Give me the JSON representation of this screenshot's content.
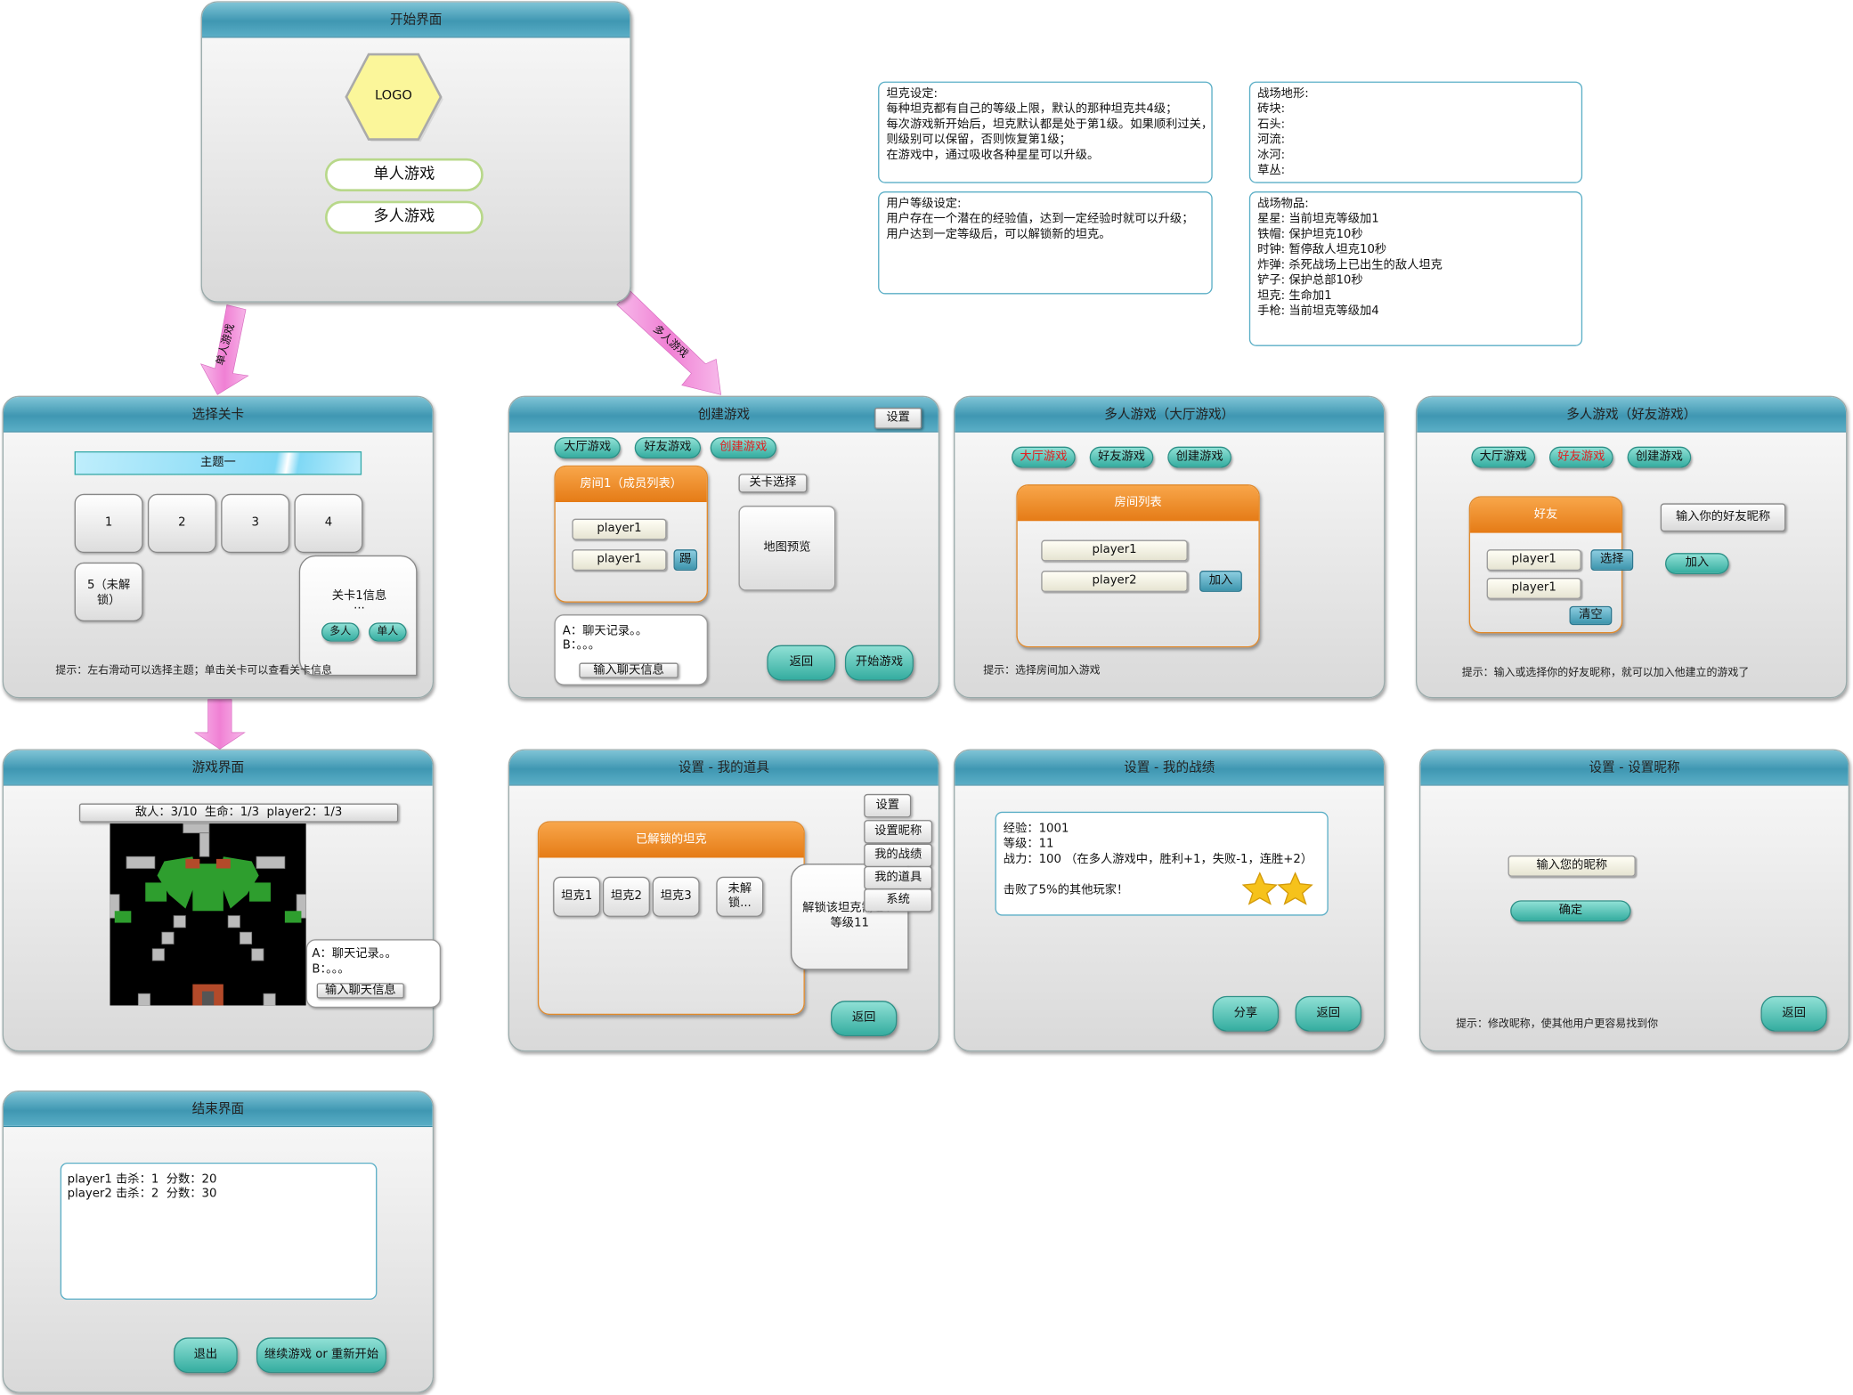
{
  "start": {
    "title": "开始界面",
    "logo": "LOGO",
    "single": "单人游戏",
    "multi": "多人游戏"
  },
  "arrows": {
    "left": "单人游戏",
    "right": "多人游戏"
  },
  "notes": {
    "tank": "坦克设定:\n每种坦克都有自己的等级上限，默认的那种坦克共4级；\n每次游戏新开始后，坦克默认都是处于第1级。如果顺利过关，\n则级别可以保留，否则恢复第1级；\n在游戏中，通过吸收各种星星可以升级。",
    "user": "用户等级设定:\n用户存在一个潜在的经验值，达到一定经验时就可以升级；\n用户达到一定等级后，可以解锁新的坦克。",
    "terrain": "战场地形:\n砖块:\n石头:\n河流:\n冰河:\n草丛:",
    "items": "战场物品:\n星星: 当前坦克等级加1\n铁帽: 保护坦克10秒\n时钟: 暂停敌人坦克10秒\n炸弹: 杀死战场上已出生的敌人坦克\n铲子: 保护总部10秒\n坦克: 生命加1\n手枪: 当前坦克等级加4"
  },
  "level": {
    "title": "选择关卡",
    "theme": "主题一",
    "tiles": [
      "1",
      "2",
      "3",
      "4"
    ],
    "locked": "5（未解锁）",
    "info_title": "关卡1信息",
    "info_dots": "...",
    "multi": "多人",
    "single": "单人",
    "hint": "提示：左右滑动可以选择主题；单击关卡可以查看关卡信息"
  },
  "create": {
    "title": "创建游戏",
    "settings": "设置",
    "tabs": [
      "大厅游戏",
      "好友游戏",
      "创建游戏"
    ],
    "room": "房间1（成员列表）",
    "players": [
      "player1",
      "player1"
    ],
    "kick": "踢",
    "level_select": "关卡选择",
    "preview": "地图预览",
    "chat_a": "A：聊天记录。。",
    "chat_b": "B：。。。",
    "chat_input": "输入聊天信息",
    "back": "返回",
    "start": "开始游戏"
  },
  "lobby": {
    "title": "多人游戏（大厅游戏）",
    "tabs": [
      "大厅游戏",
      "好友游戏",
      "创建游戏"
    ],
    "list": "房间列表",
    "players": [
      "player1",
      "player2"
    ],
    "join": "加入",
    "hint": "提示：选择房间加入游戏"
  },
  "friend": {
    "title": "多人游戏（好友游戏）",
    "tabs": [
      "大厅游戏",
      "好友游戏",
      "创建游戏"
    ],
    "card": "好友",
    "players": [
      "player1",
      "player1"
    ],
    "select": "选择",
    "clear": "清空",
    "nick_input": "输入你的好友昵称",
    "join": "加入",
    "hint": "提示：输入或选择你的好友昵称，就可以加入他建立的游戏了"
  },
  "game": {
    "title": "游戏界面",
    "status": "敌人：3/10  生命：1/3  player2：1/3",
    "chat_a": "A：聊天记录。。",
    "chat_b": "B：。。。",
    "chat_input": "输入聊天信息"
  },
  "items": {
    "title": "设置 - 我的道具",
    "card": "已解锁的坦克",
    "tanks": [
      "坦克1",
      "坦克2",
      "坦克3"
    ],
    "locked": "未解锁...",
    "unlock": "解锁该坦克需要：等级11",
    "menu": [
      "设置",
      "设置昵称",
      "我的战绩",
      "我的道具",
      "系统"
    ],
    "back": "返回"
  },
  "record": {
    "title": "设置 - 我的战绩",
    "lines": [
      "经验：1001",
      "等级：11",
      "战力：100 （在多人游戏中，胜利+1，失败-1，连胜+2）",
      "",
      "击败了5%的其他玩家！"
    ],
    "share": "分享",
    "back": "返回"
  },
  "nickname": {
    "title": "设置 - 设置昵称",
    "input": "输入您的昵称",
    "ok": "确定",
    "hint": "提示：修改昵称，使其他用户更容易找到你",
    "back": "返回"
  },
  "end": {
    "title": "结束界面",
    "lines": [
      "player1 击杀：1  分数：20",
      "player2 击杀：2  分数：30"
    ],
    "quit": "退出",
    "continue": "继续游戏 or 重新开始"
  },
  "colors": {
    "teal": "#3f97b2",
    "orange": "#e57b16",
    "button": "#35ada0",
    "arrow": "#f08ad8"
  }
}
